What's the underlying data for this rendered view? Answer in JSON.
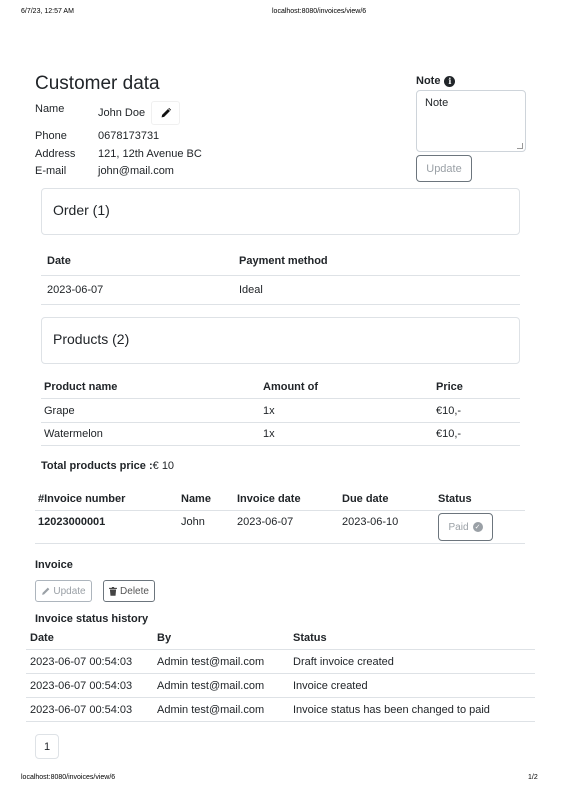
{
  "print_header": {
    "datetime": "6/7/23, 12:57 AM",
    "url": "localhost:8080/invoices/view/6"
  },
  "print_footer": {
    "url": "localhost:8080/invoices/view/6",
    "page": "1/2"
  },
  "customer": {
    "title": "Customer data",
    "name_label": "Name",
    "name": "John Doe",
    "phone_label": "Phone",
    "phone": "0678173731",
    "address_label": "Address",
    "address": "121, 12th Avenue BC",
    "email_label": "E-mail",
    "email": "john@mail.com"
  },
  "note": {
    "title": "Note",
    "value": "Note",
    "update_label": "Update"
  },
  "order": {
    "title": "Order (1)",
    "headers": [
      "Date",
      "Payment method"
    ],
    "rows": [
      [
        "2023-06-07",
        "Ideal"
      ]
    ]
  },
  "products": {
    "title": "Products (2)",
    "headers": [
      "Product name",
      "Amount of",
      "Price"
    ],
    "rows": [
      [
        "Grape",
        "1x",
        "€10,-"
      ],
      [
        "Watermelon",
        "1x",
        "€10,-"
      ]
    ],
    "total_label": "Total products price :",
    "total_value": "€ 10"
  },
  "invoice_table": {
    "headers": [
      "#Invoice number",
      "Name",
      "Invoice date",
      "Due date",
      "Status"
    ],
    "row": {
      "number": "12023000001",
      "name": "John",
      "invoice_date": "2023-06-07",
      "due_date": "2023-06-10",
      "status": "Paid"
    }
  },
  "invoice_actions": {
    "title": "Invoice",
    "update_label": "Update",
    "delete_label": "Delete"
  },
  "history": {
    "title": "Invoice status history",
    "headers": [
      "Date",
      "By",
      "Status"
    ],
    "rows": [
      [
        "2023-06-07 00:54:03",
        "Admin test@mail.com",
        "Draft invoice created"
      ],
      [
        "2023-06-07 00:54:03",
        "Admin test@mail.com",
        "Invoice created"
      ],
      [
        "2023-06-07 00:54:03",
        "Admin test@mail.com",
        "Invoice status has been changed to paid"
      ]
    ]
  },
  "pagination": {
    "current": "1"
  }
}
